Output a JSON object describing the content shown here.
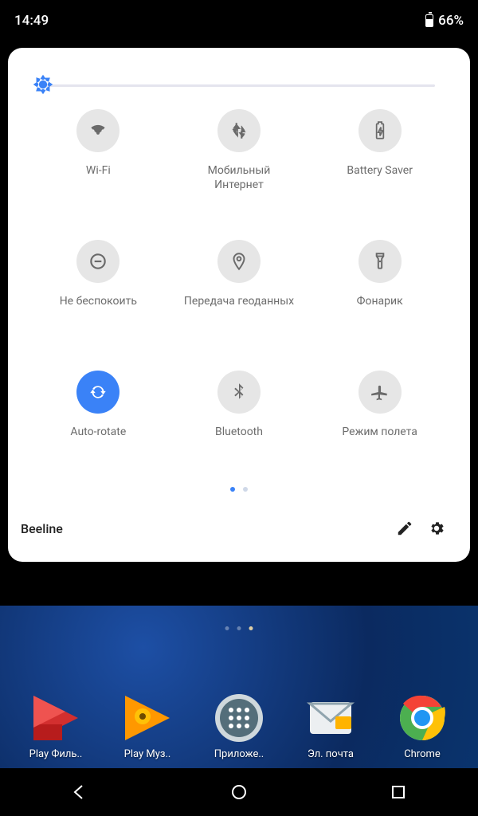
{
  "status": {
    "time": "14:49",
    "battery": "66%"
  },
  "brightness": {
    "value": 0
  },
  "tiles": [
    {
      "icon": "wifi",
      "label": "Wi-Fi",
      "on": false
    },
    {
      "icon": "data",
      "label": "Мобильный Интернет",
      "on": false
    },
    {
      "icon": "battery",
      "label": "Battery Saver",
      "on": false
    },
    {
      "icon": "dnd",
      "label": "Не беспокоить",
      "on": false
    },
    {
      "icon": "location",
      "label": "Передача геоданных",
      "on": false
    },
    {
      "icon": "flashlight",
      "label": "Фонарик",
      "on": false
    },
    {
      "icon": "rotate",
      "label": "Auto-rotate",
      "on": true
    },
    {
      "icon": "bluetooth",
      "label": "Bluetooth",
      "on": false
    },
    {
      "icon": "airplane",
      "label": "Режим полета",
      "on": false
    }
  ],
  "page_indicator": {
    "count": 2,
    "active": 0
  },
  "footer": {
    "carrier": "Beeline"
  },
  "home": {
    "page_indicator": {
      "count": 3,
      "active": 2
    },
    "dock": [
      {
        "label": "Play Филь..",
        "icon": "play-movies"
      },
      {
        "label": "Play Муз..",
        "icon": "play-music"
      },
      {
        "label": "Приложе..",
        "icon": "apps"
      },
      {
        "label": "Эл. почта",
        "icon": "mail"
      },
      {
        "label": "Chrome",
        "icon": "chrome"
      }
    ]
  }
}
